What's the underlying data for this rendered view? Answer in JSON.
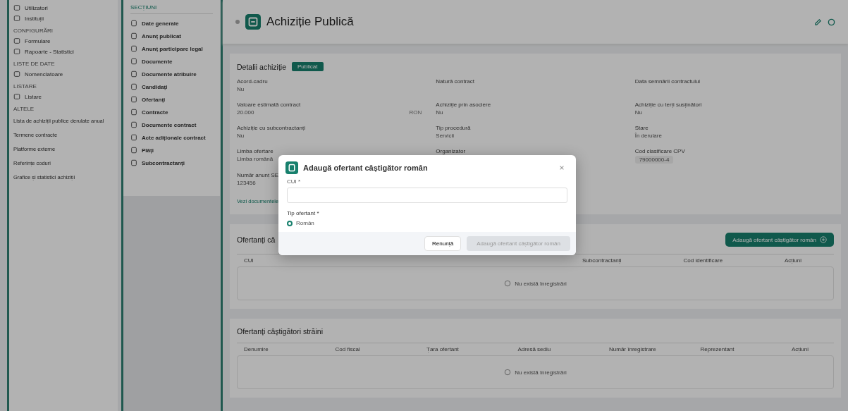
{
  "sidebar": {
    "items": [
      {
        "kind": "item",
        "label": "Utilizatori"
      },
      {
        "kind": "item",
        "label": "Instituții"
      },
      {
        "kind": "header",
        "label": "CONFIGURĂRI"
      },
      {
        "kind": "item",
        "label": "Formulare"
      },
      {
        "kind": "item",
        "label": "Rapoarte - Statistici"
      },
      {
        "kind": "header",
        "label": "LISTE DE DATE"
      },
      {
        "kind": "item",
        "label": "Nomenclatoare"
      },
      {
        "kind": "header",
        "label": "LISTARE"
      },
      {
        "kind": "item",
        "label": "Listare"
      },
      {
        "kind": "header",
        "label": "ALTELE"
      },
      {
        "kind": "link",
        "label": "Lista de achiziții publice derulate anual"
      },
      {
        "kind": "link",
        "label": "Termene contracte"
      },
      {
        "kind": "link",
        "label": "Platforme externe"
      },
      {
        "kind": "link",
        "label": "Referințe coduri"
      },
      {
        "kind": "link",
        "label": "Grafice și statistici achiziții"
      }
    ]
  },
  "sections": {
    "header": "SECȚIUNI",
    "items": [
      "Date generale",
      "Anunț publicat",
      "Anunț participare legal",
      "Documente",
      "Documente atribuire",
      "Candidați",
      "Ofertanți",
      "Contracte",
      "Documente contract",
      "Acte adiționale contract",
      "Plăți",
      "Subcontractanți"
    ]
  },
  "page": {
    "title": "Achiziție Publică"
  },
  "details": {
    "title": "Detalii achiziție",
    "badge": "Publicat",
    "fields": [
      {
        "label": "Acord-cadru",
        "value": "Nu"
      },
      {
        "label": "Natură contract"
      },
      {
        "label": "Data semnării contractului"
      },
      {
        "label": "Valoare estimată contract",
        "value": "20.000",
        "suffix": "RON"
      },
      {
        "label": "Achiziție prin asociere",
        "value": "Nu"
      },
      {
        "label": "Achiziție cu terți susținători",
        "value": "Nu"
      },
      {
        "label": "Achiziție cu subcontractanți",
        "value": "Nu"
      },
      {
        "label": "Tip procedură",
        "value": "Servicii"
      },
      {
        "label": "Stare",
        "value": "În derulare"
      },
      {
        "label": "Limba ofertare",
        "value": "Limba română"
      },
      {
        "label": "Organizator"
      },
      {
        "label": "Cod clasificare CPV",
        "chip": "79000000-4"
      },
      {
        "label": "Număr anunț SE",
        "value": "123456"
      }
    ],
    "link": "Vezi documentele"
  },
  "romanian": {
    "title": "Ofertanți câ",
    "button": "Adaugă ofertant câștigător român",
    "columns": [
      "CUI",
      "Subcontractanți",
      "Cod identificare",
      "Acțiuni"
    ],
    "empty": "Nu există înregistrări"
  },
  "foreign": {
    "title": "Ofertanți câștigători străini",
    "columns": [
      "Denumire",
      "Cod fiscal",
      "Țara ofertant",
      "Adresă sediu",
      "Număr înregistrare",
      "Reprezentant",
      "Acțiuni"
    ],
    "empty": "Nu există înregistrări"
  },
  "modal": {
    "title": "Adaugă ofertant câștigător român",
    "field_label": "CUI *",
    "radio_label": "Tip ofertant *",
    "options": [
      {
        "label": "Român",
        "selected": true
      }
    ],
    "cancel": "Renunță",
    "submit": {
      "label": "Adaugă ofertant câștigător român",
      "disabled": true
    }
  }
}
